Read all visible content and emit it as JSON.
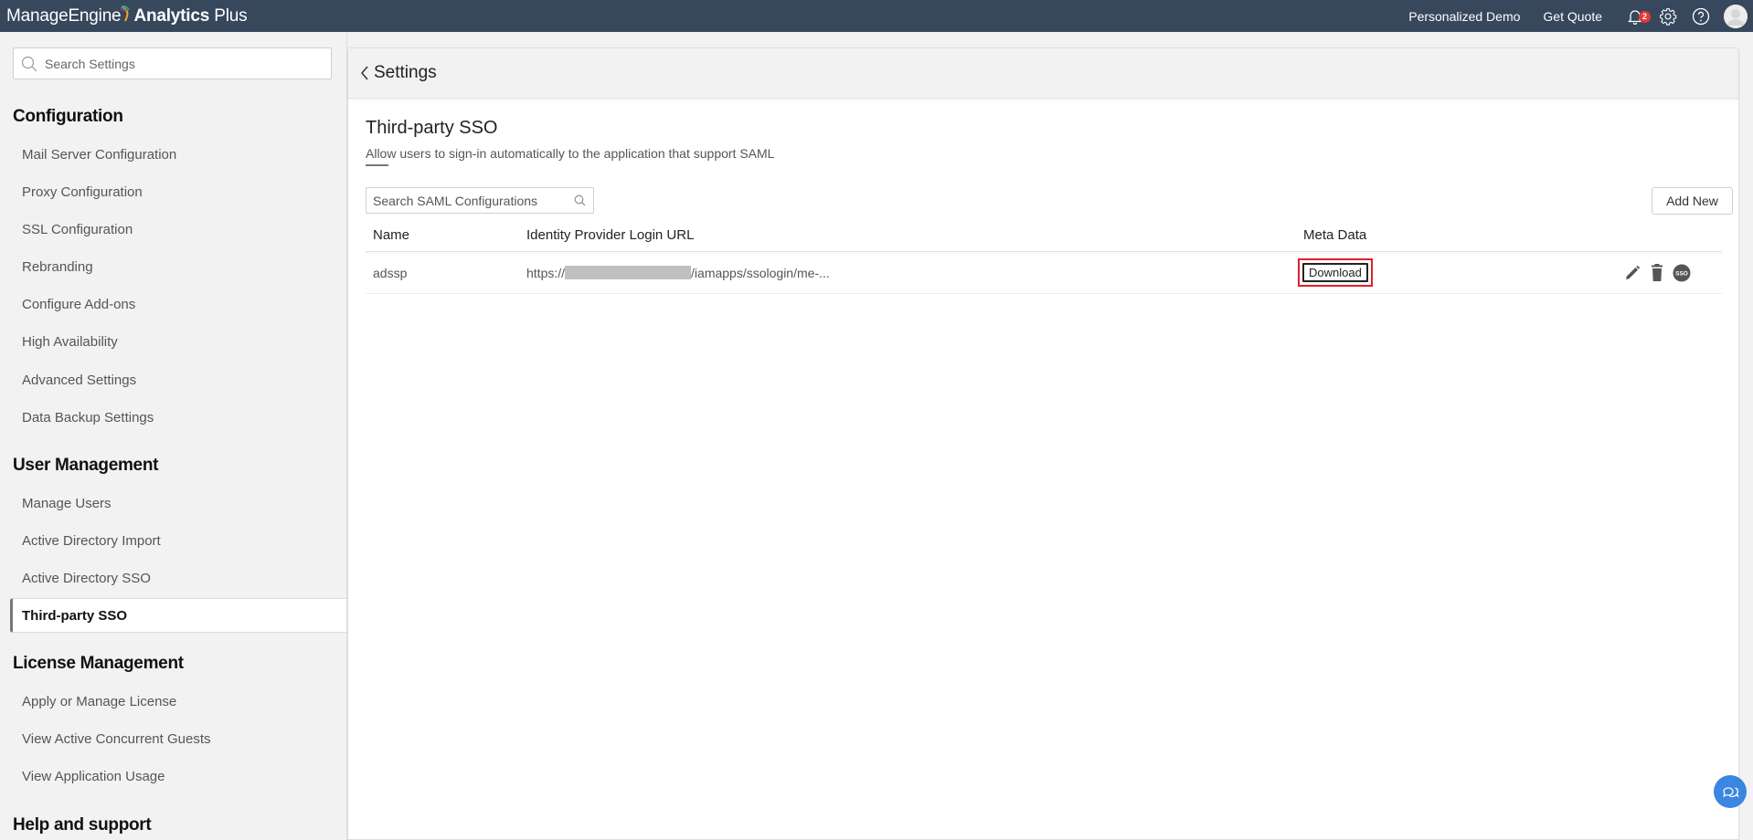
{
  "topbar": {
    "brand_company": "ManageEngine",
    "brand_product": "Analytics",
    "brand_product_suffix": "Plus",
    "links": [
      "Personalized Demo",
      "Get Quote"
    ],
    "notification_count": "2",
    "icons": [
      "bell-icon",
      "gear-icon",
      "help-icon",
      "avatar"
    ]
  },
  "sidebar": {
    "search_placeholder": "Search Settings",
    "sections": [
      {
        "heading": "Configuration",
        "items": [
          {
            "label": "Mail Server Configuration"
          },
          {
            "label": "Proxy Configuration"
          },
          {
            "label": "SSL Configuration"
          },
          {
            "label": "Rebranding"
          },
          {
            "label": "Configure Add-ons"
          },
          {
            "label": "High Availability"
          },
          {
            "label": "Advanced Settings"
          },
          {
            "label": "Data Backup Settings"
          }
        ]
      },
      {
        "heading": "User Management",
        "items": [
          {
            "label": "Manage Users"
          },
          {
            "label": "Active Directory Import"
          },
          {
            "label": "Active Directory SSO"
          },
          {
            "label": "Third-party SSO",
            "active": true
          }
        ]
      },
      {
        "heading": "License Management",
        "items": [
          {
            "label": "Apply or Manage License"
          },
          {
            "label": "View Active Concurrent Guests"
          },
          {
            "label": "View Application Usage"
          }
        ]
      },
      {
        "heading": "Help and support",
        "items": []
      }
    ]
  },
  "main": {
    "back_label": "Settings",
    "title": "Third-party SSO",
    "subtitle": "Allow users to sign-in automatically to the application that support SAML",
    "search_placeholder": "Search SAML Configurations",
    "add_new_label": "Add New",
    "table": {
      "columns": [
        "Name",
        "Identity Provider Login URL",
        "Meta Data",
        ""
      ],
      "rows": [
        {
          "name": "adssp",
          "url_prefix": "https://",
          "url_suffix": "/iamapps/ssologin/me-...",
          "meta_action": "Download",
          "actions": [
            "edit-icon",
            "delete-icon",
            "sso-icon"
          ]
        }
      ]
    }
  },
  "colors": {
    "topbar_bg": "#37475c",
    "highlight_border": "#e0202a",
    "badge": "#e53935",
    "chat_fab": "#3b86e0"
  }
}
